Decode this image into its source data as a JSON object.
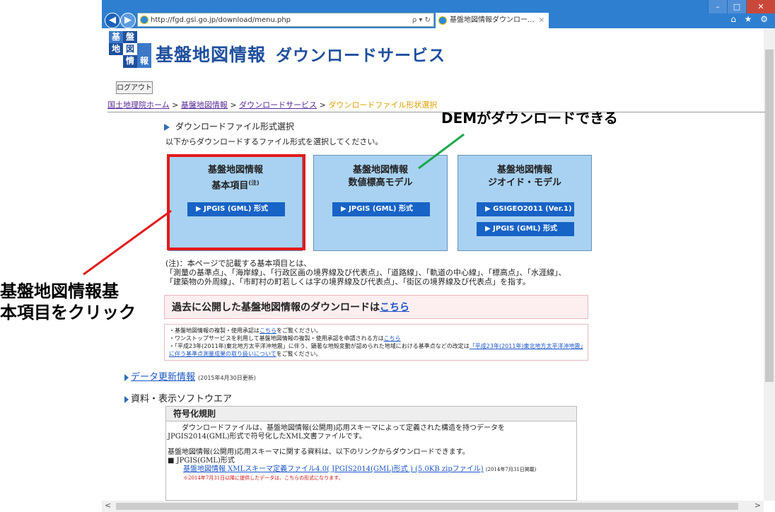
{
  "browser": {
    "url": "http://fgd.gsi.go.jp/download/menu.php",
    "url_host": "fgd.gsi.go.jp",
    "address_icons": "ρ ▾ ↻",
    "tab_title": "基盤地図情報ダウンロー...",
    "tab_close": "×",
    "window_buttons": [
      "–",
      "□",
      "✕"
    ],
    "toolbar_icons": "⌂ ★ ⚙",
    "scroll_left": "<",
    "scroll_right": ">"
  },
  "header": {
    "logo_chars": [
      "基",
      "盤",
      "地",
      "図",
      "情",
      "報"
    ],
    "site_title_main": "基盤地図情報",
    "site_title_sub": "ダウンロードサービス"
  },
  "logout_label": "ログアウト",
  "breadcrumb": {
    "items": [
      "国土地理院ホーム",
      "基盤地図情報",
      "ダウンロードサービス"
    ],
    "separator": " > ",
    "current": "ダウンロードファイル形状選択"
  },
  "section": {
    "title": "ダウンロードファイル形式選択",
    "description": "以下からダウンロードするファイル形式を選択してください。"
  },
  "boxes": [
    {
      "title1": "基盤地図情報",
      "title2": "基本項目",
      "sup": "(注)",
      "buttons": [
        "▶ JPGIS (GML) 形式"
      ]
    },
    {
      "title1": "基盤地図情報",
      "title2": "数値標高モデル",
      "sup": "",
      "buttons": [
        "▶ JPGIS (GML) 形式"
      ]
    },
    {
      "title1": "基盤地図情報",
      "title2": "ジオイド・モデル",
      "sup": "",
      "buttons": [
        "▶ GSIGEO2011 (Ver.1)",
        "▶ JPGIS (GML) 形式"
      ]
    }
  ],
  "note": {
    "line1": "(注)：本ページで記載する基本項目とは、",
    "line2": "「測量の基準点」、「海岸線」、「行政区画の境界線及び代表点」、「道路線」、「軌道の中心線」、「標高点」、「水涯線」、",
    "line3": "「建築物の外周線」、「市町村の町若しくは字の境界線及び代表点」、「街区の境界線及び代表点」を指す。"
  },
  "past": {
    "text": "過去に公開した基盤地図情報のダウンロードは",
    "link": "こちら"
  },
  "small_notes": {
    "l1a": "・基盤地図情報の複製・使用承認は",
    "l1link": "こちら",
    "l1b": "をご覧ください。",
    "l2a": "・ワンストップサービスを利用して基盤地図情報の複製・使用承認を申請される方は",
    "l2link": "こちら",
    "l3a": "・「平成23年(2011年)東北地方太平洋沖地震」に伴う、顕著な地殻変動が認められた地域における基準点などの改定は",
    "l3link": "「平成23年(2011年)東北地方太平洋沖地震」に伴う基準点測量成果の取り扱いについて",
    "l3b": "をご覧ください。"
  },
  "update": {
    "link": "データ更新情報",
    "date": "(2015年4月30日更新)"
  },
  "software_title": "資料・表示ソフトウエア",
  "encoding": {
    "heading": "符号化規則",
    "p1a": "ダウンロードファイルは、基盤地図情報(公開用)応用スキーマによって定義された構造を持つデータを",
    "p1b": "JPGIS2014(GML)形式で符号化したXML文書ファイルです。",
    "p2": "基盤地図情報(公開用)応用スキーマに関する資料は、以下のリンクからダウンロードできます。",
    "bullet": "■  JPGIS(GML)形式",
    "file_link": "基盤地図情報 XMLスキーマ定義ファイル4.0( JPGIS2014(GML)形式 ) (5.0KB  zipファイル)",
    "file_date": "(2014年7月31日掲載)",
    "red_note": "※2014年7月31日以降に提供したデータは、こちらの形式になります。"
  },
  "annotations": {
    "dem": "DEMがダウンロードできる",
    "click_line1": "基盤地図情報基",
    "click_line2": "本項目をクリック"
  },
  "colors": {
    "red_annotation": "#e31b1b",
    "green_annotation": "#19a84a",
    "box_fill": "#a9d2f2",
    "button_fill": "#1763c6"
  }
}
